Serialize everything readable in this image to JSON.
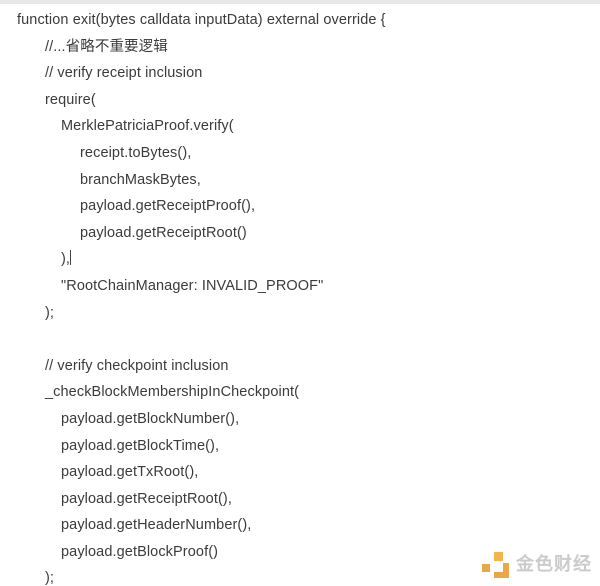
{
  "app": {
    "background_color": "#ffffff",
    "text_color": "#3b3b3b",
    "top_strip_color": "#e8e8e8"
  },
  "editor": {
    "caret_after_line_index": 9,
    "lines": [
      {
        "indent": 0,
        "text": "function exit(bytes calldata inputData) external override {"
      },
      {
        "indent": 1,
        "text": "//...省略不重要逻辑"
      },
      {
        "indent": 1,
        "text": "// verify receipt inclusion"
      },
      {
        "indent": 1,
        "text": "require("
      },
      {
        "indent": 2,
        "text": "MerklePatriciaProof.verify("
      },
      {
        "indent": 3,
        "text": "receipt.toBytes(),"
      },
      {
        "indent": 3,
        "text": "branchMaskBytes,"
      },
      {
        "indent": 3,
        "text": "payload.getReceiptProof(),"
      },
      {
        "indent": 3,
        "text": "payload.getReceiptRoot()"
      },
      {
        "indent": 2,
        "text": "),"
      },
      {
        "indent": 2,
        "text": "\"RootChainManager: INVALID_PROOF\""
      },
      {
        "indent": 1,
        "text": ");"
      },
      {
        "indent": 0,
        "text": ""
      },
      {
        "indent": 1,
        "text": "// verify checkpoint inclusion"
      },
      {
        "indent": 1,
        "text": "_checkBlockMembershipInCheckpoint("
      },
      {
        "indent": 2,
        "text": "payload.getBlockNumber(),"
      },
      {
        "indent": 2,
        "text": "payload.getBlockTime(),"
      },
      {
        "indent": 2,
        "text": "payload.getTxRoot(),"
      },
      {
        "indent": 2,
        "text": "payload.getReceiptRoot(),"
      },
      {
        "indent": 2,
        "text": "payload.getHeaderNumber(),"
      },
      {
        "indent": 2,
        "text": "payload.getBlockProof()"
      },
      {
        "indent": 1,
        "text": ");"
      }
    ]
  },
  "watermark": {
    "brand_text": "金色财经",
    "logo_color_primary": "#e8a33d",
    "logo_color_secondary": "#f0b243",
    "text_color": "#c9c9c9"
  }
}
